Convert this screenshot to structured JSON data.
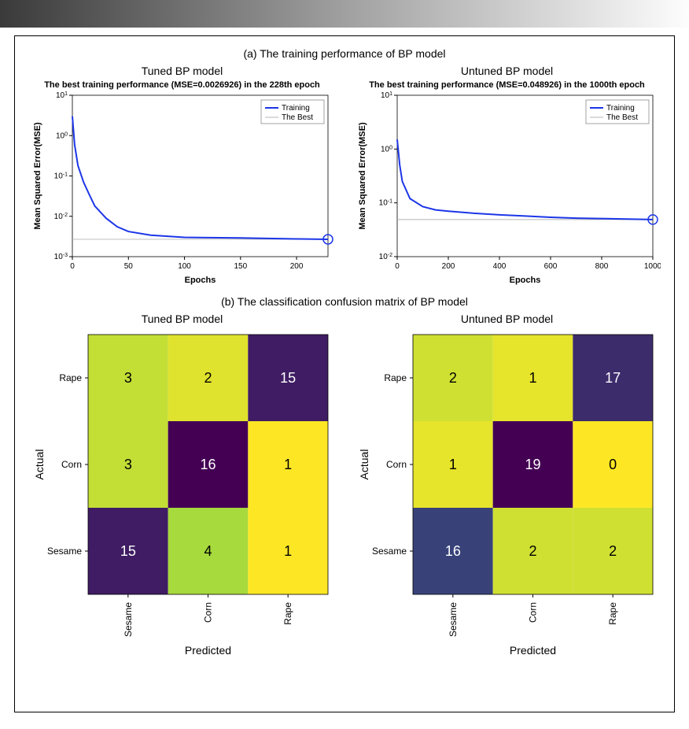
{
  "chart_data": [
    {
      "type": "line",
      "section_title": "(a) The training performance of BP model",
      "subtitle": "Tuned BP model",
      "title": "The best training performance (MSE=0.0026926) in the 228th epoch",
      "xlabel": "Epochs",
      "ylabel": "Mean Squared Error(MSE)",
      "xlim": [
        0,
        228
      ],
      "ylim": [
        0.001,
        10.0
      ],
      "yticks": [
        "10^{-3}",
        "10^{-2}",
        "10^{-1}",
        "10^{0}",
        "10^{1}"
      ],
      "xticks": [
        0,
        50,
        100,
        150,
        200
      ],
      "legend": [
        "Training",
        "The Best"
      ],
      "best_value": 0.0026926,
      "best_epoch": 228,
      "series": [
        {
          "name": "Training",
          "data": [
            [
              0,
              3.0
            ],
            [
              2,
              0.6
            ],
            [
              5,
              0.18
            ],
            [
              10,
              0.07
            ],
            [
              15,
              0.035
            ],
            [
              20,
              0.018
            ],
            [
              30,
              0.009
            ],
            [
              40,
              0.0055
            ],
            [
              50,
              0.0042
            ],
            [
              70,
              0.0034
            ],
            [
              100,
              0.003
            ],
            [
              150,
              0.0029
            ],
            [
              200,
              0.00275
            ],
            [
              228,
              0.0026926
            ]
          ]
        }
      ]
    },
    {
      "type": "line",
      "subtitle": "Untuned BP model",
      "title": "The best training performance (MSE=0.048926) in the 1000th epoch",
      "xlabel": "Epochs",
      "ylabel": "Mean Squared Error(MSE)",
      "xlim": [
        0,
        1000
      ],
      "ylim": [
        0.01,
        10.0
      ],
      "yticks": [
        "10^{-2}",
        "10^{-1}",
        "10^{0}",
        "10^{1}"
      ],
      "xticks": [
        0,
        200,
        400,
        600,
        800,
        1000
      ],
      "legend": [
        "Training",
        "The Best"
      ],
      "best_value": 0.048926,
      "best_epoch": 1000,
      "series": [
        {
          "name": "Training",
          "data": [
            [
              0,
              1.5
            ],
            [
              10,
              0.5
            ],
            [
              20,
              0.25
            ],
            [
              50,
              0.12
            ],
            [
              100,
              0.085
            ],
            [
              150,
              0.074
            ],
            [
              200,
              0.07
            ],
            [
              300,
              0.064
            ],
            [
              400,
              0.06
            ],
            [
              500,
              0.057
            ],
            [
              600,
              0.054
            ],
            [
              700,
              0.052
            ],
            [
              800,
              0.051
            ],
            [
              900,
              0.05
            ],
            [
              1000,
              0.048926
            ]
          ]
        }
      ]
    },
    {
      "type": "heatmap",
      "section_title": "(b) The classification confusion matrix of BP model",
      "subtitle": "Tuned BP model",
      "xlabel": "Predicted",
      "ylabel": "Actual",
      "x_categories": [
        "Sesame",
        "Corn",
        "Rape"
      ],
      "y_categories": [
        "Rape",
        "Corn",
        "Sesame"
      ],
      "values": [
        [
          3,
          2,
          15
        ],
        [
          3,
          16,
          1
        ],
        [
          15,
          4,
          1
        ]
      ]
    },
    {
      "type": "heatmap",
      "subtitle": "Untuned BP model",
      "xlabel": "Predicted",
      "ylabel": "Actual",
      "x_categories": [
        "Sesame",
        "Corn",
        "Rape"
      ],
      "y_categories": [
        "Rape",
        "Corn",
        "Sesame"
      ],
      "values": [
        [
          2,
          1,
          17
        ],
        [
          1,
          19,
          0
        ],
        [
          16,
          2,
          2
        ]
      ]
    }
  ],
  "colors": {
    "training_line": "#1c36e8",
    "best_line": "#b5b5b5",
    "viridis": {
      "0": "#fde725",
      "4": "#5ec962",
      "8": "#21918c",
      "12": "#3b528b",
      "16": "#440154",
      "20": "#440154"
    }
  }
}
